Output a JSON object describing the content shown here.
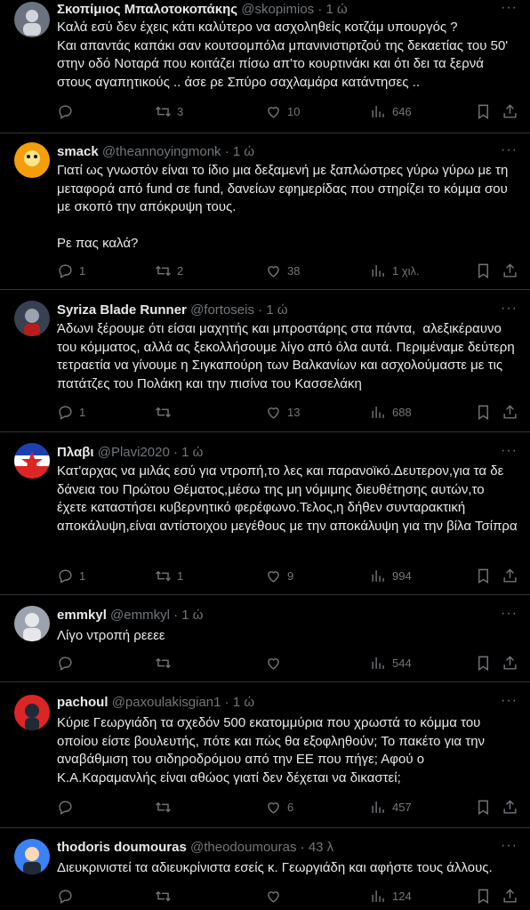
{
  "tweets": [
    {
      "name": "Σκοπίμιος Μπαλοτοκοπάκης",
      "handle": "@skopimios",
      "time": "· 1 ώ",
      "text": "Καλά εσύ δεν έχεις κάτι καλύτερο να ασχοληθείς κοτζάμ υπουργός ?\nΚαι απαντάς καπάκι σαν κουτσομπόλα μπανινιστιρτζού της δεκαετίας του 50' στην οδό Νοταρά που κοιτάζει πίσω απ'το κουρτινάκι και ότι δει τα ξερνά στους αγαπητικούς .. άσε ρε Σπύρο σαχλαμάρα κατάντησες ..",
      "replies": "",
      "retweets": "3",
      "likes": "10",
      "views": "646",
      "avatar_color": "#6b7280"
    },
    {
      "name": "smack",
      "handle": "@theannoyingmonk",
      "time": "· 1 ώ",
      "text": "Γιατί ως γνωστόν είναι το ίδιο μια δεξαμενή με ξαπλώστρες γύρω γύρω με τη μεταφορά από fund σε fund, δανείων εφημερίδας που στηρίζει το κόμμα σου με σκοπό την απόκρυψη τους.\n\nΡε πας καλά?",
      "replies": "1",
      "retweets": "2",
      "likes": "38",
      "views": "1 χιλ.",
      "avatar_color": "#f59e0b"
    },
    {
      "name": "Syriza Blade Runner",
      "handle": "@fortoseis",
      "time": "· 1 ώ",
      "text": "Άδωνι ξέρουμε ότι είσαι μαχητής και μπροστάρης στα πάντα,  αλεξικέραυνο του κόμματος, αλλά ας ξεκολλήσουμε λίγο από όλα αυτά. Περιμέναμε δεύτερη τετραετία να γίνουμε η Σιγκαπούρη των Βαλκανίων και ασχολούμαστε με τις πατάτζες του Πολάκη και την πισίνα του Κασσελάκη",
      "replies": "1",
      "retweets": "",
      "likes": "13",
      "views": "688",
      "avatar_color": "#374151"
    },
    {
      "name": "Πλαβι",
      "handle": "@Plavi2020",
      "time": "· 1 ώ",
      "text": "Κατ'αρχας να μιλάς εσύ για ντροπή,το λες και παρανοϊκό.Δευτερον,για τα δε δάνεια του Πρώτου Θέματος,μέσω της μη νόμιμης διευθέτησης αυτών,το έχετε καταστήσει κυβερνητικό φερέφωνο.Τελος,η δήθεν συνταρακτική αποκάλυψη,είναι αντίστοιχου μεγέθους με την αποκάλυψη για την βίλα Τσίπρα",
      "replies": "1",
      "retweets": "1",
      "likes": "9",
      "views": "994",
      "avatar_color": "#1e40af"
    },
    {
      "name": "emmkyl",
      "handle": "@emmkyl",
      "time": "· 1 ώ",
      "text": "Λίγο ντροπή ρεεεε",
      "replies": "",
      "retweets": "",
      "likes": "",
      "views": "544",
      "avatar_color": "#9ca3af"
    },
    {
      "name": "pachoul",
      "handle": "@paxoulakisgian1",
      "time": "· 1 ώ",
      "text": "Κύριε Γεωργιάδη τα σχεδόν 500 εκατομμύρια που χρωστά το κόμμα του οποίου είστε βουλευτής, πότε και πώς θα εξοφληθούν; Το πακέτο για την αναβάθμιση του σιδηροδρόμου από την ΕΕ που πήγε; Αφού ο Κ.Α.Καραμανλής είναι αθώος γιατί δεν δέχεται να δικαστεί;",
      "replies": "",
      "retweets": "",
      "likes": "6",
      "views": "457",
      "avatar_color": "#dc2626"
    },
    {
      "name": "thodoris doumouras",
      "handle": "@theodoumouras",
      "time": "· 43 λ",
      "text": "Διευκρινιστεί τα αδιευκρίνιστα εσείς κ. Γεωργιάδη και αφήστε τους άλλους.",
      "replies": "",
      "retweets": "",
      "likes": "",
      "views": "124",
      "avatar_color": "#3b82f6"
    }
  ]
}
